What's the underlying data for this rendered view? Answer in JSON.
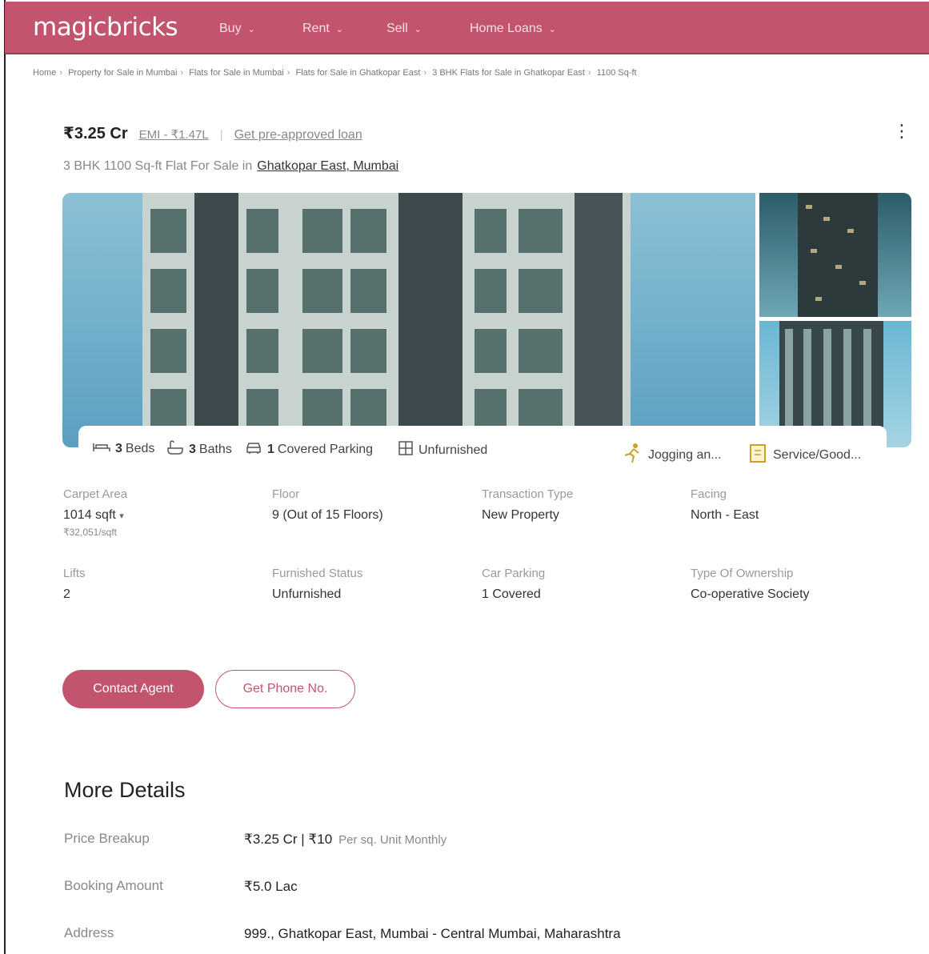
{
  "header": {
    "logo": "magicbricks",
    "nav": [
      "Buy",
      "Rent",
      "Sell",
      "Home Loans"
    ]
  },
  "breadcrumb": [
    "Home",
    "Property for Sale in Mumbai",
    "Flats for Sale in Mumbai",
    "Flats for Sale in Ghatkopar East",
    "3 BHK Flats for Sale in Ghatkopar East",
    "1100 Sq-ft"
  ],
  "listing": {
    "price": "₹3.25 Cr",
    "emi": "EMI - ₹1.47L",
    "loan_link": "Get pre-approved loan",
    "subtitle": "3 BHK 1100 Sq-ft Flat For Sale in",
    "location": "Ghatkopar East, Mumbai"
  },
  "features": {
    "beds_num": "3",
    "beds_label": "Beds",
    "baths_num": "3",
    "baths_label": "Baths",
    "parking_num": "1",
    "parking_label": "Covered Parking",
    "furnishing": "Unfurnished",
    "jogging": "Jogging an...",
    "service": "Service/Good..."
  },
  "details": [
    {
      "label": "Carpet Area",
      "value": "1014 sqft",
      "sub": "₹32,051/sqft"
    },
    {
      "label": "Floor",
      "value": "9 (Out of 15 Floors)"
    },
    {
      "label": "Transaction Type",
      "value": "New Property"
    },
    {
      "label": "Facing",
      "value": "North - East"
    },
    {
      "label": "Lifts",
      "value": "2"
    },
    {
      "label": "Furnished Status",
      "value": "Unfurnished"
    },
    {
      "label": "Car Parking",
      "value": "1 Covered"
    },
    {
      "label": "Type Of Ownership",
      "value": "Co-operative Society"
    }
  ],
  "buttons": {
    "contact": "Contact Agent",
    "phone": "Get Phone No."
  },
  "more": {
    "title": "More Details",
    "rows": [
      {
        "label": "Price Breakup",
        "value": "₹3.25 Cr | ₹10",
        "unit": "Per sq. Unit Monthly"
      },
      {
        "label": "Booking Amount",
        "value": "₹5.0 Lac"
      },
      {
        "label": "Address",
        "value": "999., Ghatkopar East, Mumbai - Central Mumbai, Maharashtra"
      }
    ]
  },
  "colors": {
    "brand": "#c2546e",
    "text": "#303030",
    "muted": "#999999"
  }
}
